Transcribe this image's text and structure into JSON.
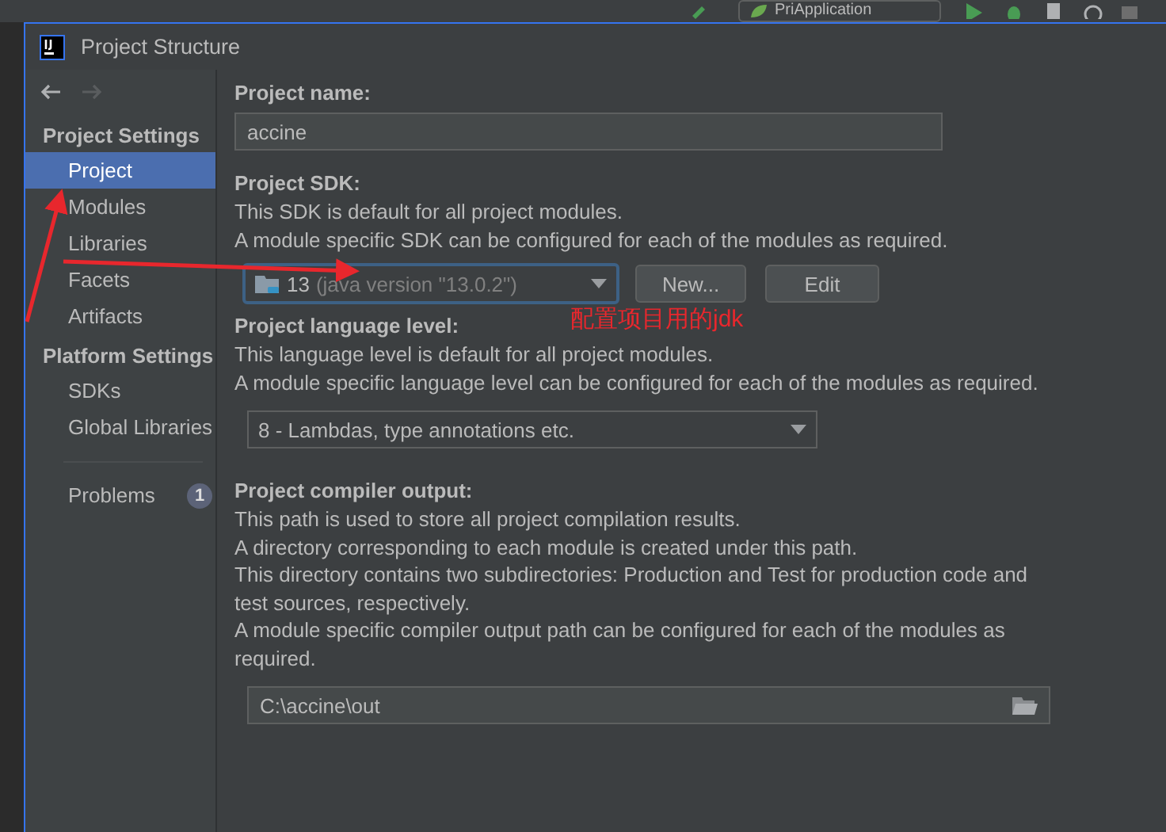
{
  "background_toolbar": {
    "run_configuration": "PriApplication"
  },
  "window": {
    "title": "Project Structure"
  },
  "navigation": {
    "back_disabled": false,
    "forward_disabled": true
  },
  "sidebar": {
    "sections": [
      {
        "heading": "Project Settings",
        "items": [
          {
            "label": "Project",
            "selected": true
          },
          {
            "label": "Modules",
            "selected": false
          },
          {
            "label": "Libraries",
            "selected": false
          },
          {
            "label": "Facets",
            "selected": false
          },
          {
            "label": "Artifacts",
            "selected": false
          }
        ]
      },
      {
        "heading": "Platform Settings",
        "items": [
          {
            "label": "SDKs",
            "selected": false
          },
          {
            "label": "Global Libraries",
            "selected": false
          }
        ]
      }
    ],
    "problems": {
      "label": "Problems",
      "count": "1"
    }
  },
  "project_name": {
    "label": "Project name:",
    "value": "accine"
  },
  "project_sdk": {
    "label": "Project SDK:",
    "description": [
      "This SDK is default for all project modules.",
      "A module specific SDK can be configured for each of the modules as required."
    ],
    "version": "13",
    "detail": "(java version \"13.0.2\")",
    "buttons": [
      "New...",
      "Edit"
    ]
  },
  "annotation": {
    "text": "配置项目用的jdk"
  },
  "language_level": {
    "label": "Project language level:",
    "description": [
      "This language level is default for all project modules.",
      "A module specific language level can be configured for each of the modules as required."
    ],
    "value": "8 - Lambdas, type annotations etc."
  },
  "compiler_output": {
    "label": "Project compiler output:",
    "description": [
      "This path is used to store all project compilation results.",
      "A directory corresponding to each module is created under this path.",
      "This directory contains two subdirectories: Production and Test for production code and",
      "test sources, respectively.",
      "A module specific compiler output path can be configured for each of the modules as",
      "required."
    ],
    "value": "C:\\accine\\out"
  }
}
